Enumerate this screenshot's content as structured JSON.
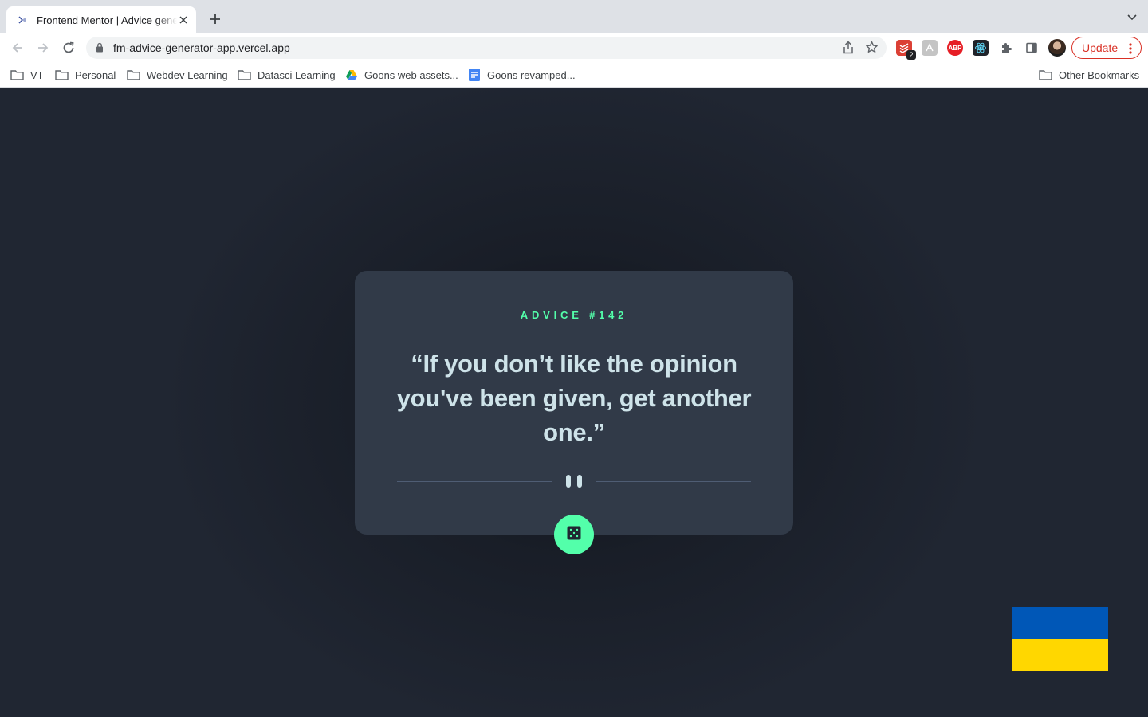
{
  "browser": {
    "tab": {
      "title": "Frontend Mentor | Advice generator app",
      "favicon": "frontend-mentor-favicon"
    },
    "url": "fm-advice-generator-app.vercel.app",
    "update_label": "Update",
    "extensions": [
      {
        "name": "todoist-extension-icon",
        "badge": "2",
        "color": "#db4035"
      },
      {
        "name": "grey-extension-icon",
        "badge": "",
        "color": "#c4c4c4"
      },
      {
        "name": "adblock-plus-icon",
        "label": "ABP",
        "color": "#e61e25"
      },
      {
        "name": "react-devtools-icon",
        "badge": "",
        "color": "#20232a"
      },
      {
        "name": "puzzle-extensions-icon",
        "badge": "",
        "color": "#5f6368"
      },
      {
        "name": "side-panel-icon",
        "badge": "",
        "color": "#5f6368"
      }
    ],
    "bookmarks": [
      {
        "label": "VT",
        "icon": "folder-icon"
      },
      {
        "label": "Personal",
        "icon": "folder-icon"
      },
      {
        "label": "Webdev Learning",
        "icon": "folder-icon"
      },
      {
        "label": "Datasci Learning",
        "icon": "folder-icon"
      },
      {
        "label": "Goons web assets...",
        "icon": "google-drive-icon"
      },
      {
        "label": "Goons revamped...",
        "icon": "google-docs-icon"
      }
    ],
    "other_bookmarks": "Other Bookmarks"
  },
  "advice": {
    "id_label": "ADVICE #142",
    "quote": "“If you don’t like the opinion you've been given, get another one.”"
  },
  "colors": {
    "accent": "#53ffaa",
    "card": "#313a48",
    "background": "#202632",
    "text": "#cee3e9",
    "flag_blue": "#0057b7",
    "flag_yellow": "#ffd700"
  }
}
